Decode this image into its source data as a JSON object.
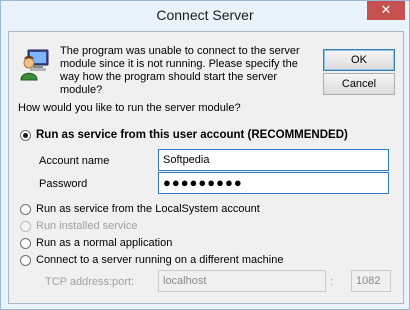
{
  "window": {
    "title": "Connect Server",
    "close_glyph": "✕"
  },
  "dialog": {
    "icon": "computer-user-icon",
    "message": "The program was unable to connect to the server module since it is not running. Please specify the way how the program should start the server module?",
    "buttons": {
      "ok": "OK",
      "cancel": "Cancel"
    },
    "question": "How would you like to run the server module?",
    "options": [
      {
        "label": "Run as service from this user account (RECOMMENDED)",
        "selected": true,
        "enabled": true
      },
      {
        "label": "Run as service from the LocalSystem account",
        "selected": false,
        "enabled": true
      },
      {
        "label": "Run installed service",
        "selected": false,
        "enabled": false
      },
      {
        "label": "Run as a normal application",
        "selected": false,
        "enabled": true
      },
      {
        "label": "Connect to a server running on a different machine",
        "selected": false,
        "enabled": true
      }
    ],
    "account": {
      "name_label": "Account name",
      "name_value": "Softpedia",
      "password_label": "Password",
      "password_mask": "●●●●●●●●●"
    },
    "tcp": {
      "label": "TCP address:port:",
      "address": "localhost",
      "separator": ":",
      "port": "1082"
    }
  },
  "colors": {
    "title_bar": "#eaf3fc",
    "close_button": "#c75050",
    "dialog_background": "#f0f0f0",
    "input_border": "#2e7bc9"
  }
}
